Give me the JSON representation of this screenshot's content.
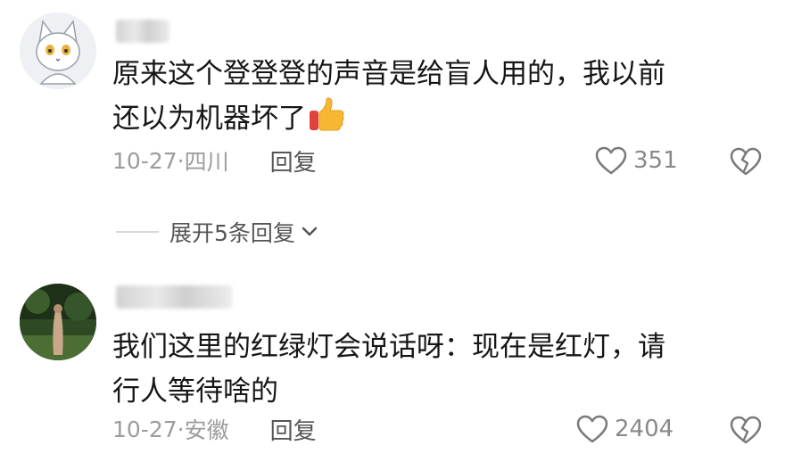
{
  "comments": [
    {
      "text_line1": "原来这个登登登的声音是给盲人用的，我以前",
      "text_line2": "还以为机器坏了",
      "emoji": "thumbs-up-icon",
      "date": "10-27",
      "separator": "·",
      "location": "四川",
      "reply_label": "回复",
      "likes": "351"
    },
    {
      "text_line1": "我们这里的红绿灯会说话呀：现在是红灯，请",
      "text_line2": "行人等待啥的",
      "date": "10-27",
      "separator": "·",
      "location": "安徽",
      "reply_label": "回复",
      "likes": "2404"
    }
  ],
  "expand_replies": {
    "label": "展开5条回复"
  },
  "colors": {
    "text": "#161616",
    "meta": "#9c9c9c",
    "accent": "#555555"
  }
}
